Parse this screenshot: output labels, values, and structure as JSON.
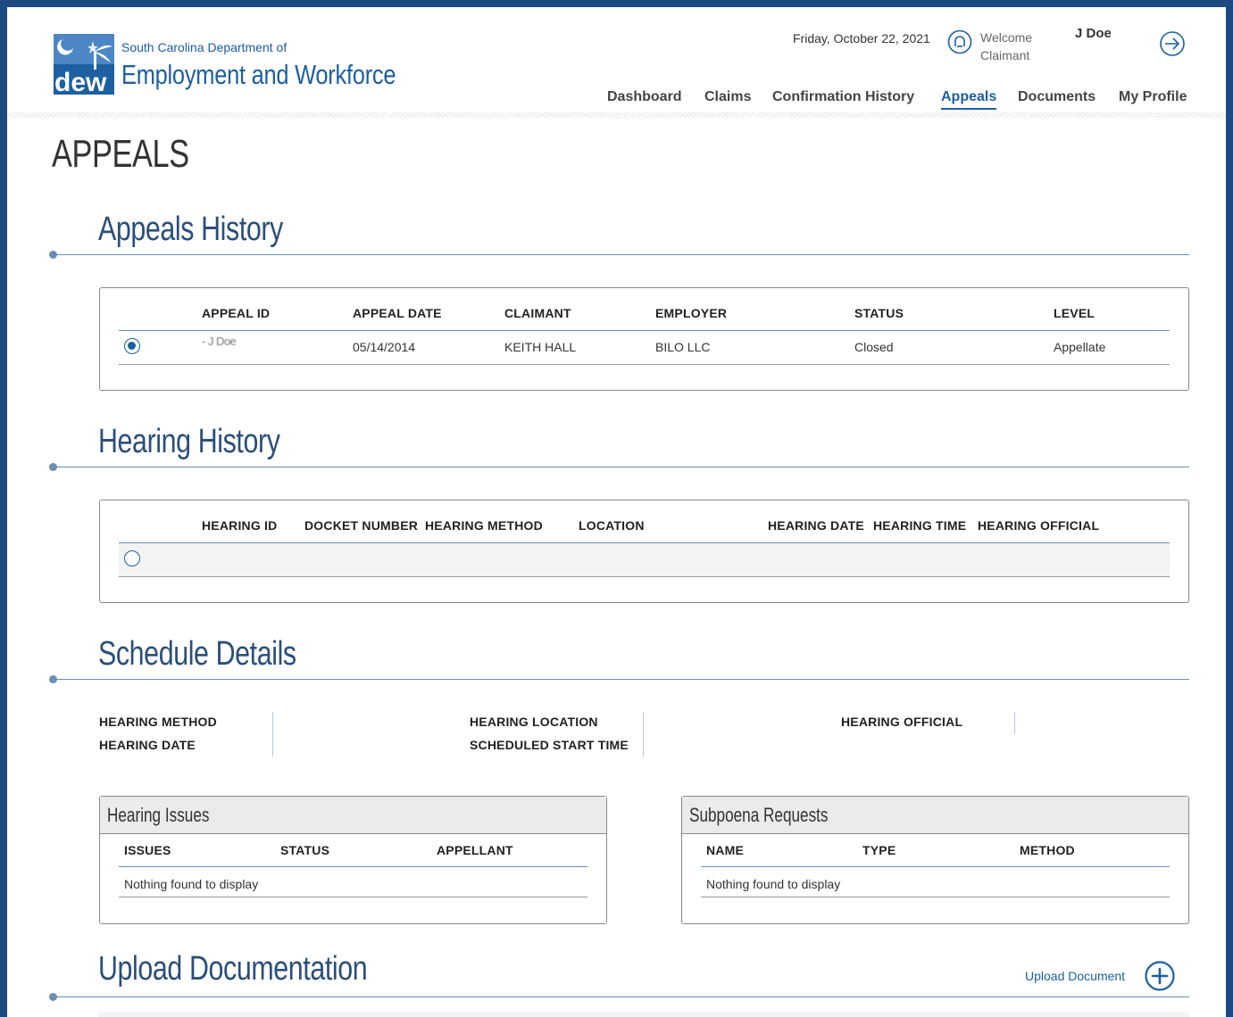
{
  "header": {
    "dept_line1": "South Carolina Department of",
    "dept_line2": "Employment and Workforce",
    "logo_text": "dew",
    "date": "Friday, October 22, 2021",
    "welcome": "Welcome",
    "role": "Claimant",
    "user": "J Doe",
    "brand_color": "#1d5fa0"
  },
  "nav": [
    {
      "label": "Dashboard"
    },
    {
      "label": "Claims"
    },
    {
      "label": "Confirmation History"
    },
    {
      "label": "Appeals",
      "active": true
    },
    {
      "label": "Documents"
    },
    {
      "label": "My Profile"
    }
  ],
  "page": {
    "title": "APPEALS"
  },
  "appeals_history": {
    "title": "Appeals History",
    "columns": [
      "APPEAL ID",
      "APPEAL DATE",
      "CLAIMANT",
      "EMPLOYER",
      "STATUS",
      "LEVEL"
    ],
    "rows": [
      {
        "selected": true,
        "appeal_id": "- J Doe",
        "appeal_date": "05/14/2014",
        "claimant": "KEITH HALL",
        "employer": "BILO LLC",
        "status": "Closed",
        "level": "Appellate"
      }
    ]
  },
  "hearing_history": {
    "title": "Hearing History",
    "columns": [
      "HEARING ID",
      "DOCKET NUMBER",
      "HEARING METHOD",
      "LOCATION",
      "HEARING DATE",
      "HEARING TIME",
      "HEARING OFFICIAL"
    ]
  },
  "schedule_details": {
    "title": "Schedule Details",
    "hearing_method": "HEARING METHOD",
    "hearing_date": "HEARING DATE",
    "hearing_location": "HEARING LOCATION",
    "scheduled_start_time": "SCHEDULED START TIME",
    "hearing_official": "HEARING OFFICIAL"
  },
  "hearing_issues": {
    "title": "Hearing Issues",
    "columns": [
      "ISSUES",
      "STATUS",
      "APPELLANT"
    ],
    "empty": "Nothing found to display"
  },
  "subpoena_requests": {
    "title": "Subpoena Requests",
    "columns": [
      "NAME",
      "TYPE",
      "METHOD"
    ],
    "empty": "Nothing found to display"
  },
  "upload_documentation": {
    "title": "Upload Documentation",
    "link": "Upload Document"
  }
}
